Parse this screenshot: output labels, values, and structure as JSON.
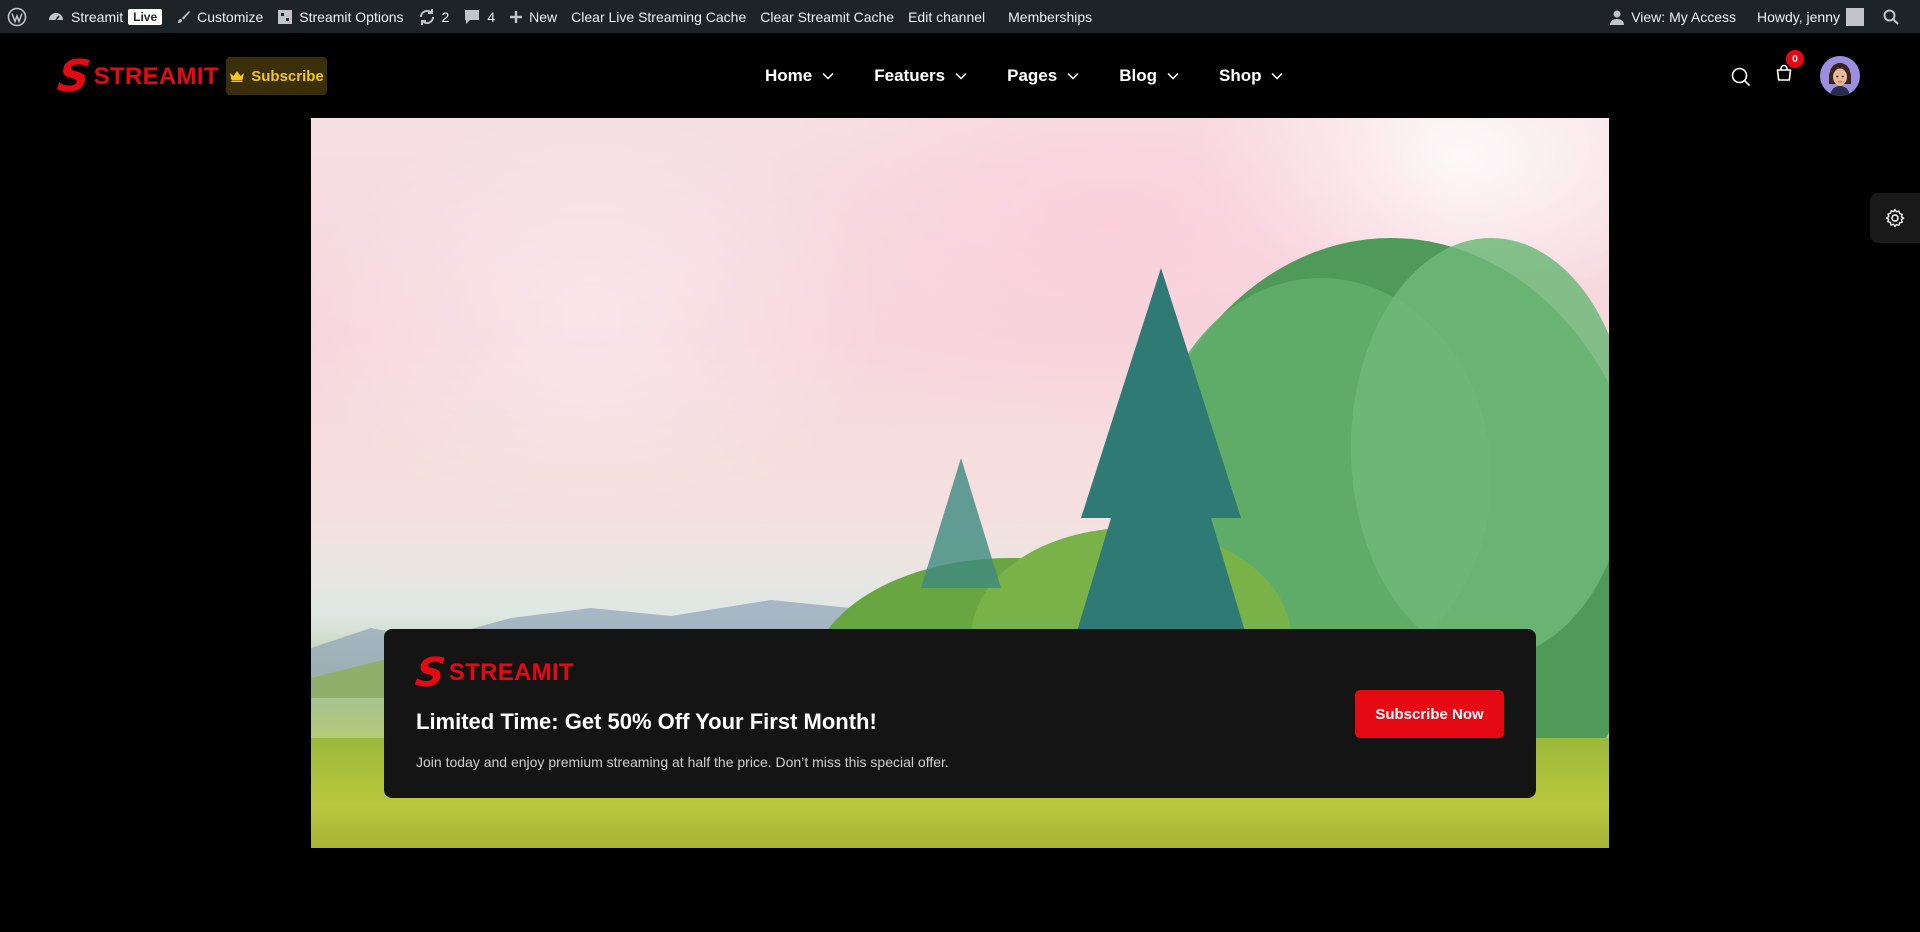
{
  "adminbar": {
    "site_name": "Streamit",
    "live_label": "Live",
    "customize": "Customize",
    "options": "Streamit Options",
    "updates_count": "2",
    "comments_count": "4",
    "new_label": "New",
    "clear_live": "Clear Live Streaming Cache",
    "clear_streamit": "Clear Streamit Cache",
    "edit_channel": "Edit channel",
    "memberships": "Memberships",
    "view_access": "View: My Access",
    "howdy": "Howdy, jenny"
  },
  "header": {
    "logo_text": "STREAMIT",
    "logo_letter": "S",
    "subscribe_label": "Subscribe",
    "nav": [
      {
        "label": "Home"
      },
      {
        "label": "Featuers"
      },
      {
        "label": "Pages"
      },
      {
        "label": "Blog"
      },
      {
        "label": "Shop"
      }
    ],
    "cart_count": "0"
  },
  "promo": {
    "logo_letter": "S",
    "logo_text": "STREAMIT",
    "title": "Limited Time: Get 50% Off Your First Month!",
    "text": "Join today and enjoy premium streaming at half the price. Don’t miss this special offer.",
    "button": "Subscribe Now"
  },
  "colors": {
    "brand_red": "#e50914",
    "admin_bar": "#1d2327",
    "subscribe_gold": "#f5c518"
  },
  "icons": [
    "wordpress-icon",
    "dashboard-icon",
    "brush-icon",
    "options-icon",
    "updates-icon",
    "comments-icon",
    "plus-icon",
    "user-icon",
    "search-icon",
    "crown-icon",
    "chevron-down-icon",
    "cart-icon",
    "gear-icon"
  ]
}
